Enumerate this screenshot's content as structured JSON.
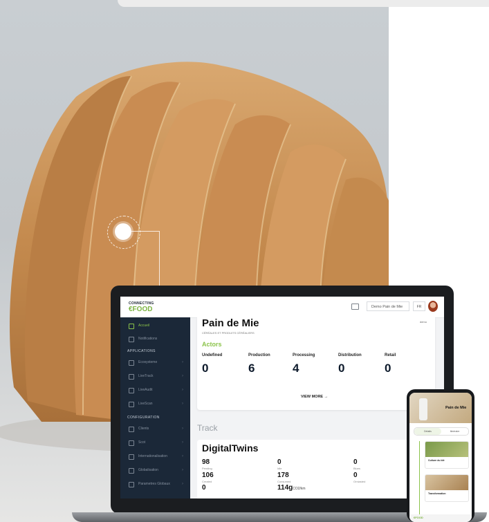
{
  "brand": {
    "logo_top": "CONNECTING",
    "logo_main": "€FOOD"
  },
  "header": {
    "product_select": "Demo Pain de Mie",
    "language": "FR"
  },
  "sidebar": {
    "items": [
      {
        "label": "Accueil",
        "active": true
      },
      {
        "label": "Notifications"
      }
    ],
    "applications_label": "APPLICATIONS",
    "apps": [
      "Ecosysteme",
      "LiveTrack",
      "LiveAudit",
      "LiveScan"
    ],
    "configuration_label": "CONFIGURATION",
    "config": [
      "Clients",
      "Scot",
      "Internationalisation",
      "Globalisation",
      "Parametres Globaux"
    ]
  },
  "product": {
    "title": "Pain de Mie",
    "subtitle": "CÉRÉALES ET PRODUITS CÉRÉALIERS",
    "tag": "demo"
  },
  "actors": {
    "label": "Actors",
    "stats": [
      {
        "label": "Undefined",
        "value": "0"
      },
      {
        "label": "Production",
        "value": "6"
      },
      {
        "label": "Processing",
        "value": "4"
      },
      {
        "label": "Distribution",
        "value": "0"
      },
      {
        "label": "Retail",
        "value": "0"
      }
    ],
    "view_more": "VIEW MORE →"
  },
  "track": {
    "heading": "Track"
  },
  "digital_twins": {
    "title": "DigitalTwins",
    "col1": [
      {
        "value": "98",
        "label": "Pending"
      },
      {
        "value": "106",
        "label": "Created"
      },
      {
        "value": "0",
        "label": ""
      }
    ],
    "col2": [
      {
        "value": "0",
        "label": "Idle"
      },
      {
        "value": "178",
        "label": "Consumed"
      },
      {
        "value": "114g",
        "unit": "CO2/km"
      }
    ],
    "col3": [
      {
        "value": "0",
        "label": "Blues"
      },
      {
        "value": "0",
        "label": "Orniasted"
      }
    ]
  },
  "phone": {
    "title": "Pain de Mie",
    "tabs": [
      "Détails",
      "Itinéraire"
    ],
    "cards": [
      {
        "label": "Culture du blé"
      },
      {
        "label": "Transformation"
      }
    ],
    "footer_logo": "€FOOD"
  },
  "colors": {
    "accent": "#8bc34a",
    "sidebar": "#1b2838",
    "navy": "#0d1a2b"
  }
}
